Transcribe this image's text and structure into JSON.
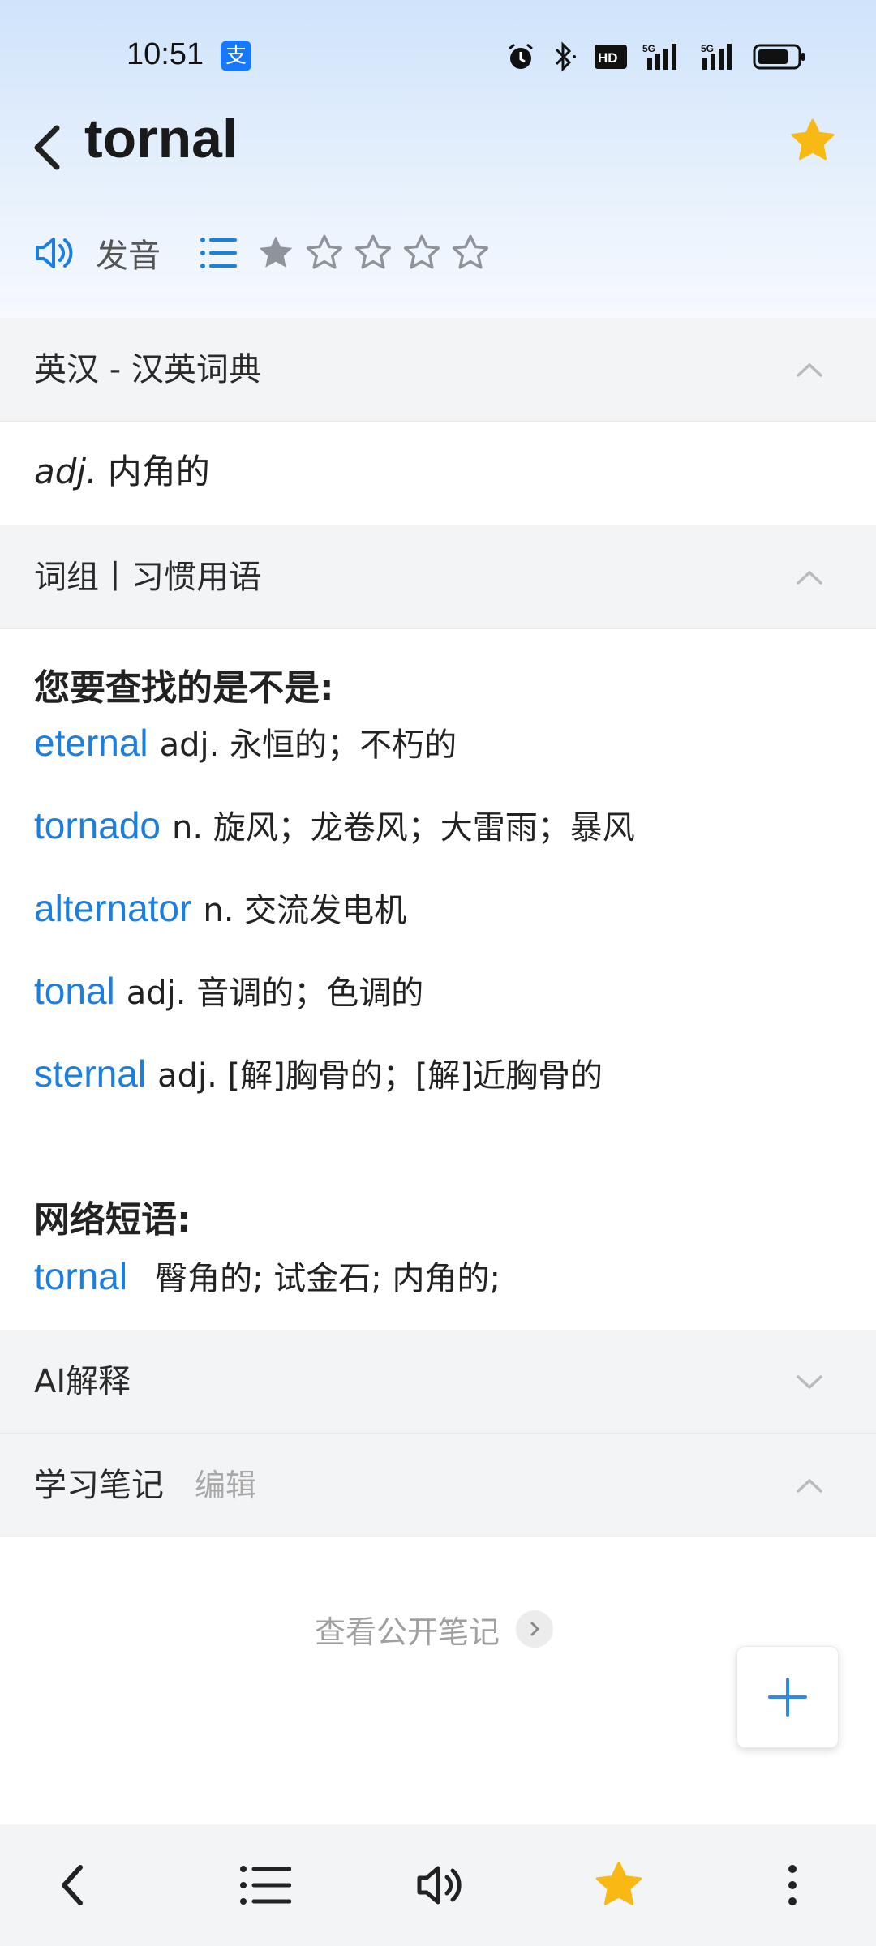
{
  "status_bar": {
    "time": "10:51",
    "alipay_glyph": "支",
    "icons": [
      "alarm-icon",
      "bluetooth-icon",
      "hd-icon",
      "signal-5g-icon",
      "signal-5g-icon",
      "battery-icon"
    ]
  },
  "header": {
    "word": "tornal",
    "favorite_color": "#f9b915"
  },
  "pronunciation": {
    "label": "发音",
    "rating": 1,
    "rating_max": 5
  },
  "sections": {
    "dict": {
      "title": "英汉 - 汉英词典",
      "expanded": true
    },
    "phrases": {
      "title": "词组丨习惯用语",
      "expanded": true
    },
    "ai": {
      "title": "AI解释",
      "expanded": false
    },
    "notes": {
      "title": "学习笔记",
      "edit_label": "编辑",
      "expanded": true
    }
  },
  "definition": {
    "pos": "adj.",
    "meaning": "内角的"
  },
  "did_you_mean": {
    "title": "您要查找的是不是:",
    "items": [
      {
        "word": "eternal",
        "desc": "adj. 永恒的；不朽的"
      },
      {
        "word": "tornado",
        "desc": "n. 旋风；龙卷风；大雷雨；暴风"
      },
      {
        "word": "alternator",
        "desc": "n. 交流发电机"
      },
      {
        "word": "tonal",
        "desc": "adj. 音调的；色调的"
      },
      {
        "word": "sternal",
        "desc": "adj. [解]胸骨的；[解]近胸骨的"
      }
    ]
  },
  "web_phrases": {
    "title": "网络短语:",
    "word": "tornal",
    "desc": "臀角的; 试金石; 内角的;"
  },
  "notes": {
    "public_label": "查看公开笔记"
  },
  "colors": {
    "accent": "#1a7fe0",
    "star": "#f9b915",
    "section_bg": "#f3f4f6"
  },
  "bottom_nav": [
    "back-icon",
    "list-icon",
    "speaker-icon",
    "star-icon",
    "more-icon"
  ]
}
